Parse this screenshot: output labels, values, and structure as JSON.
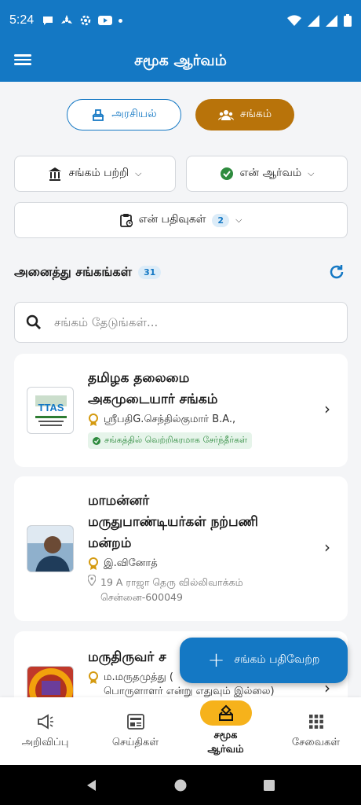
{
  "status_bar": {
    "time": "5:24"
  },
  "app_bar": {
    "title": "சமூக ஆர்வம்"
  },
  "toggles": {
    "politics_label": "அரசியல்",
    "association_label": "சங்கம்"
  },
  "filters": {
    "about_label": "சங்கம் பற்றி",
    "my_interest_label": "என் ஆர்வம்",
    "my_posts_label": "என் பதிவுகள்",
    "my_posts_count": "2"
  },
  "list": {
    "title": "அனைத்து சங்கங்கள்",
    "count": "31",
    "search_placeholder": "சங்கம் தேடுங்கள்..."
  },
  "cards": [
    {
      "name_line1": "தமிழக தலைமை",
      "name_line2": "அகமுடையார் சங்கம்",
      "person": "ஸ்ரீபதிG.செந்தில்குமார் B.A.,",
      "badge": "சங்கத்தில் வெற்றிகரமாக சேர்ந்தீர்கள்",
      "logo_text": "TTAS"
    },
    {
      "name_line1": "மாமன்னர்",
      "name_line2": "மருதுபாண்டியர்கள் நற்பணி",
      "name_line3": "மன்றம்",
      "person": "இ.வினோத்",
      "addr_line1": "19 A ராஜா தெரு வில்லிவாக்கம்",
      "addr_line2": "சென்னை-600049"
    },
    {
      "name_line1": "மருதிருவர் ச",
      "person": "ம.மருதமுத்து (",
      "addr_line2": "பொருளாளர் என்று எதுவும் இல்லை)"
    }
  ],
  "fab": {
    "label": "சங்கம் பதிவேற்ற"
  },
  "bottom_nav": {
    "announcements": "அறிவிப்பு",
    "news": "செய்திகள்",
    "social_line1": "சமூக",
    "social_line2": "ஆர்வம்",
    "services": "சேவைகள்"
  },
  "colors": {
    "primary": "#1478c4",
    "accent": "#b8730a",
    "active_nav": "#f6b21b",
    "success": "#2e8b3e"
  }
}
